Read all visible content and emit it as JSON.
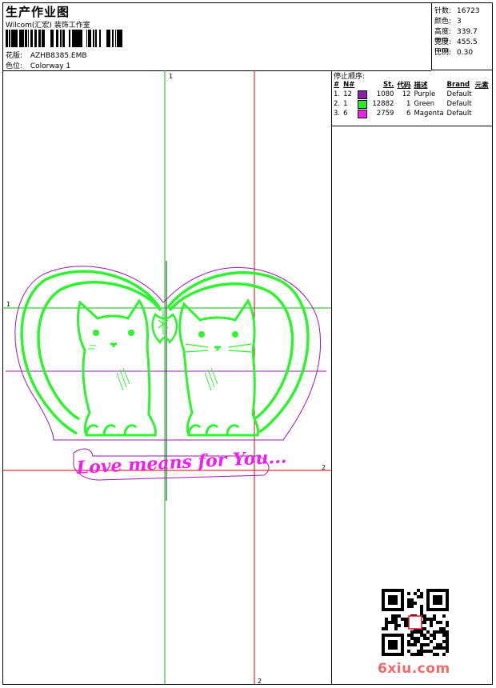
{
  "header": {
    "title": "生产作业图",
    "studio": "Wilcom(汇宏) 装饰工作室",
    "design_label": "花版:",
    "design_value": "AZHB8385.EMB",
    "colorway_label": "色位:",
    "colorway_value": "Colorway 1"
  },
  "specs": [
    {
      "label": "针数:",
      "value": "16723"
    },
    {
      "label": "颜色:",
      "value": "3"
    },
    {
      "label": "高度:",
      "value": "339.7 mm"
    },
    {
      "label": "宽度:",
      "value": "455.5 mm"
    },
    {
      "label": "比例:",
      "value": "0.30"
    }
  ],
  "stop_sequence": {
    "title": "停止顺序:",
    "headers": [
      "#",
      "N#",
      "",
      "St.",
      "代码",
      "描述",
      "Brand",
      "元素"
    ],
    "rows": [
      {
        "index": "1.",
        "needle": "12",
        "color": "#8b1fb0",
        "stitches": "1080",
        "code": "12",
        "description": "Purple",
        "brand": "Default"
      },
      {
        "index": "2.",
        "needle": "1",
        "color": "#22ee22",
        "stitches": "12882",
        "code": "1",
        "description": "Green",
        "brand": "Default"
      },
      {
        "index": "3.",
        "needle": "6",
        "color": "#ee22ee",
        "stitches": "2759",
        "code": "6",
        "description": "Magenta",
        "brand": "Default"
      }
    ]
  },
  "design": {
    "text": "Love means for You...",
    "guide_labels": {
      "v1": "1",
      "h1": "1",
      "h2": "2",
      "v2": "2"
    },
    "colors": {
      "green": "#2ef42e",
      "purple": "#9a19b4",
      "magenta": "#f01cf0",
      "red_guide": "#e00000",
      "green_guide": "#00c000",
      "dark_guide": "#2a5a3a"
    }
  },
  "footer": {
    "site": "6xiu.com"
  }
}
